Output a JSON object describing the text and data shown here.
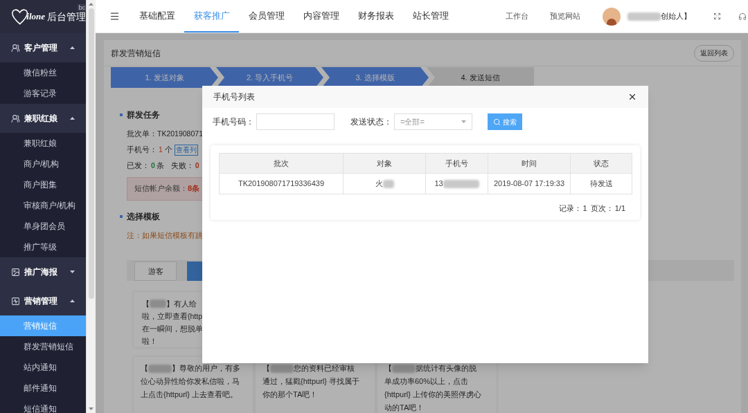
{
  "sidebar": {
    "logo": {
      "script": "ilone",
      "title": "后台管理",
      "badge": "bc"
    },
    "groups": [
      {
        "label": "客户管理",
        "expanded": true,
        "children": [
          {
            "label": "微信粉丝",
            "selected": false
          },
          {
            "label": "游客记录",
            "selected": false
          }
        ]
      },
      {
        "label": "兼职红娘",
        "expanded": true,
        "children": [
          {
            "label": "兼职红娘",
            "selected": false
          },
          {
            "label": "商户/机构",
            "selected": false
          },
          {
            "label": "商户图集",
            "selected": false
          },
          {
            "label": "审核商户/机构",
            "selected": false
          },
          {
            "label": "单身团会员",
            "selected": false
          },
          {
            "label": "推广等级",
            "selected": false
          }
        ]
      },
      {
        "label": "推广海报",
        "expanded": false
      },
      {
        "label": "营销管理",
        "expanded": true,
        "children": [
          {
            "label": "营销短信",
            "selected": true
          },
          {
            "label": "群发营销短信",
            "selected": false
          },
          {
            "label": "站内通知",
            "selected": false
          },
          {
            "label": "邮件通知",
            "selected": false
          },
          {
            "label": "短信通知",
            "selected": false
          }
        ]
      }
    ]
  },
  "topbar": {
    "nav": [
      {
        "label": "基础配置",
        "selected": false
      },
      {
        "label": "获客推广",
        "selected": true
      },
      {
        "label": "会员管理",
        "selected": false
      },
      {
        "label": "内容管理",
        "selected": false
      },
      {
        "label": "财务报表",
        "selected": false
      },
      {
        "label": "站长管理",
        "selected": false
      }
    ],
    "links": [
      "工作台",
      "预览网站"
    ],
    "user": {
      "name_suffix": "创始人】"
    }
  },
  "page": {
    "title": "群发营销短信",
    "back_button": "返回列表",
    "steps": [
      {
        "label": "1. 发送对象",
        "completed": true
      },
      {
        "label": "2. 导入手机号",
        "completed": true
      },
      {
        "label": "3. 选择模版",
        "completed": true
      },
      {
        "label": "4. 发送短信",
        "completed": false
      }
    ],
    "task": {
      "heading": "群发任务",
      "batch": "批次单：TK201908071",
      "phone": {
        "label": "手机号：",
        "count": "1",
        "unit": "个",
        "button": "查看列"
      },
      "stats": [
        {
          "label": "已发：",
          "value": "0",
          "unit": "条",
          "kind": "success"
        },
        {
          "label": "失败：",
          "value": "0",
          "kind": "danger"
        }
      ],
      "balance": {
        "label": "短信帐户余额：",
        "value": "8条"
      }
    },
    "template": {
      "heading": "选择模板",
      "note": "注：如果短信模板有跳",
      "tabs": [
        {
          "label": "游客",
          "selected": false
        },
        {
          "selected": true
        }
      ],
      "cut_card": {
        "prefix": "【",
        "lines": [
          "】有人给",
          "啦，立即查看{http",
          "在一瞬间，想脱单",
          "啦！"
        ]
      },
      "cards": [
        {
          "prefix": "【",
          "lines": [
            "】尊敬的用户，有多",
            "位心动异性给你发私信啦，马",
            "上点击{httpurl} 上去查看吧。"
          ]
        },
        {
          "prefix": "【",
          "lines": [
            "您的资料已经审核",
            "通过，猛戳{httpurl} 寻找属于",
            "你的那个TA吧！"
          ]
        },
        {
          "prefix": "【",
          "lines": [
            "据统计有头像的脱",
            "单成功率60%以上，点击",
            "{httpurl} 上传你的美照俘虏心",
            "动的TA吧！"
          ]
        }
      ]
    }
  },
  "modal": {
    "title": "手机号列表",
    "phone_label": "手机号码：",
    "status_label": "发送状态：",
    "status_value": "=全部=",
    "search_button": "搜索",
    "table": {
      "columns": [
        "批次",
        "对象",
        "手机号",
        "时间",
        "状态"
      ],
      "rows": [
        {
          "batch": "TK201908071719336439",
          "target": "火",
          "phone": "13",
          "time": "2019-08-07 17:19:33",
          "status": "待发送"
        }
      ]
    },
    "records_label": "记录：",
    "records": "1",
    "pages_label": "页次：",
    "pages": "1/1"
  }
}
